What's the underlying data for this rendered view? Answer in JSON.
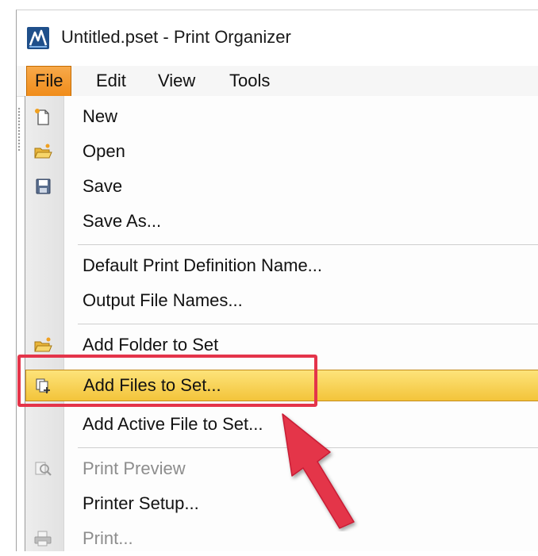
{
  "window": {
    "title": "Untitled.pset - Print Organizer",
    "app_icon": "print-organizer-icon"
  },
  "menubar": {
    "items": [
      {
        "label": "File",
        "active": true
      },
      {
        "label": "Edit",
        "active": false
      },
      {
        "label": "View",
        "active": false
      },
      {
        "label": "Tools",
        "active": false
      }
    ]
  },
  "file_menu": {
    "items": [
      {
        "label": "New",
        "icon": "new-document-icon",
        "enabled": true
      },
      {
        "label": "Open",
        "icon": "open-folder-icon",
        "enabled": true
      },
      {
        "label": "Save",
        "icon": "save-disk-icon",
        "enabled": true
      },
      {
        "label": "Save As...",
        "icon": "",
        "enabled": true
      },
      {
        "label": "Default Print Definition Name...",
        "icon": "",
        "enabled": true
      },
      {
        "label": "Output File Names...",
        "icon": "",
        "enabled": true
      },
      {
        "label": "Add Folder to Set",
        "icon": "add-folder-icon",
        "enabled": true
      },
      {
        "label": "Add Files to Set...",
        "icon": "add-files-icon",
        "enabled": true,
        "highlighted": true
      },
      {
        "label": "Add Active File to Set...",
        "icon": "",
        "enabled": true
      },
      {
        "label": "Print Preview",
        "icon": "print-preview-icon",
        "enabled": false
      },
      {
        "label": "Printer Setup...",
        "icon": "",
        "enabled": true
      },
      {
        "label": "Print...",
        "icon": "printer-icon",
        "enabled": false
      }
    ]
  },
  "annotation": {
    "highlight_color": "#e4344a",
    "arrow_color": "#e4344a"
  }
}
